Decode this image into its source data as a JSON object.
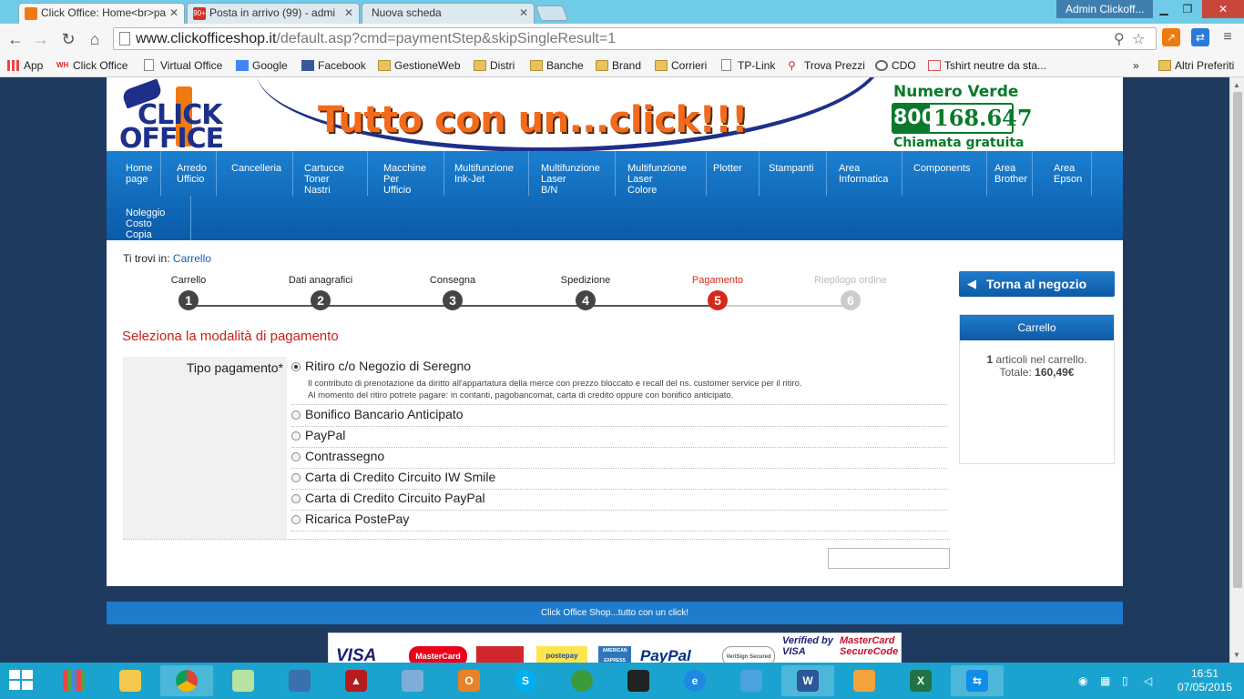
{
  "browser": {
    "tabs": [
      {
        "title": "Click Office: Home<br>pa",
        "active": true
      },
      {
        "title": "Posta in arrivo (99) - admi",
        "badge": "90+"
      },
      {
        "title": "Nuova scheda"
      }
    ],
    "window_user": "Admin Clickoff...",
    "url_domain": "www.clickofficeshop.it",
    "url_rest": "/default.asp?cmd=paymentStep&skipSingleResult=1",
    "bookmarks": [
      "App",
      "Click Office",
      "Virtual Office",
      "Google",
      "Facebook",
      "GestioneWeb",
      "Distri",
      "Banche",
      "Brand",
      "Corrieri",
      "TP-Link",
      "Trova Prezzi",
      "CDO",
      "Tshirt neutre da sta...",
      "»",
      "Altri Preferiti"
    ],
    "bookmark_wh": "WH"
  },
  "site": {
    "logo_line1": "CLICK",
    "logo_line2": "OFFICE",
    "slogan": "Tutto con un...click!!!",
    "toll_free_label": "Numero Verde",
    "toll_free_prefix": "800",
    "toll_free_number": "168.647",
    "toll_free_note": "Chiamata gratuita",
    "menu": [
      "Home page",
      "Arredo Ufficio",
      "Cancelleria",
      "Cartucce Toner Nastri",
      "Macchine Per Ufficio",
      "Multifunzione Ink-Jet",
      "Multifunzione Laser B/N",
      "Multifunzione Laser Colore",
      "Plotter",
      "Stampanti",
      "Area Informatica",
      "Components",
      "Area Brother",
      "Area Epson",
      "Noleggio Costo Copia"
    ],
    "breadcrumb_prefix": "Ti trovi in:",
    "breadcrumb_link": "Carrello",
    "steps": [
      {
        "label": "Carrello",
        "num": "1"
      },
      {
        "label": "Dati anagrafici",
        "num": "2"
      },
      {
        "label": "Consegna",
        "num": "3"
      },
      {
        "label": "Spedizione",
        "num": "4"
      },
      {
        "label": "Pagamento",
        "num": "5"
      },
      {
        "label": "Riepilogo ordine",
        "num": "6"
      }
    ],
    "section_title": "Seleziona la modalità di pagamento",
    "payment_label": "Tipo pagamento*",
    "payment_options": [
      {
        "label": "Ritiro c/o Negozio di Seregno",
        "checked": true,
        "desc1": "Il contributo di prenotazione da diritto all'appartatura della merce con prezzo bloccato e recall del ns. customer service per il ritiro.",
        "desc2": "Al momento del ritiro potrete pagare: in contanti, pagobancomat, carta di credito oppure con bonifico anticipato."
      },
      {
        "label": "Bonifico Bancario Anticipato"
      },
      {
        "label": "PayPal"
      },
      {
        "label": "Contrassegno"
      },
      {
        "label": "Carta di Credito Circuito IW Smile"
      },
      {
        "label": "Carta di Credito Circuito PayPal"
      },
      {
        "label": "Ricarica PostePay"
      }
    ],
    "back_button": "Torna al negozio",
    "cart": {
      "title": "Carrello",
      "count": "1",
      "count_suffix": "articoli nel carrello.",
      "total_label": "Totale:",
      "total_value": "160,49€"
    },
    "footer": "Click Office Shop...tutto con un click!",
    "card_logos": [
      "VISA",
      "MasterCard",
      "postepay",
      "AMERICAN EXPRESS",
      "PayPal",
      "VeriSign Secured",
      "Verified by VISA",
      "MasterCard SecureCode"
    ]
  },
  "taskbar": {
    "time": "16:51",
    "date": "07/05/2015"
  },
  "colors": {
    "menu_blue": "#1b7fd0",
    "accent_red": "#c8221a",
    "taskbar": "#1ba3cf"
  }
}
